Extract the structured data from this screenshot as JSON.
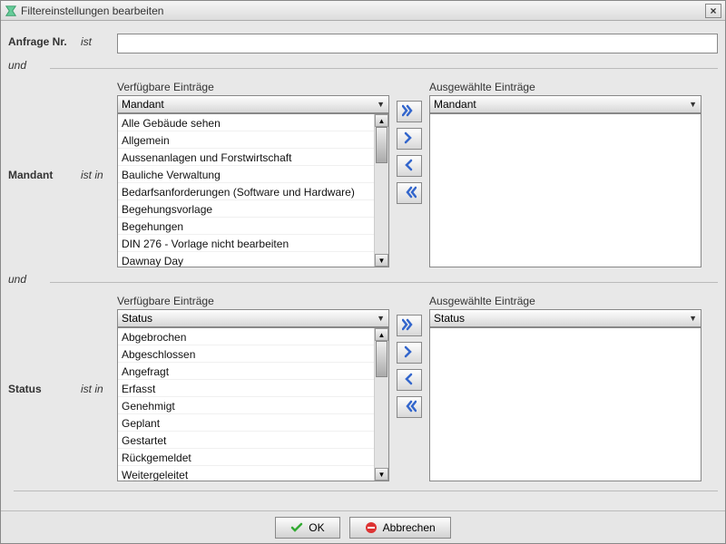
{
  "window": {
    "title": "Filtereinstellungen bearbeiten",
    "close_symbol": "×"
  },
  "fields": {
    "anfrage_label": "Anfrage Nr.",
    "op_ist": "ist",
    "and": "und",
    "mandant_label": "Mandant",
    "op_istin": "ist in",
    "status_label": "Status",
    "available_title": "Verfügbare Einträge",
    "selected_title": "Ausgewählte Einträge",
    "anfrage_value": ""
  },
  "mandant": {
    "dropdown_value": "Mandant",
    "available": [
      "Alle Gebäude sehen",
      "Allgemein",
      "Aussenanlagen und Forstwirtschaft",
      "Bauliche Verwaltung",
      "Bedarfsanforderungen (Software und Hardware)",
      "Begehungsvorlage",
      "Begehungen",
      "DIN 276 - Vorlage nicht bearbeiten",
      "Dawnay Day"
    ],
    "selected_dropdown_value": "Mandant"
  },
  "status": {
    "dropdown_value": "Status",
    "available": [
      "Abgebrochen",
      "Abgeschlossen",
      "Angefragt",
      "Erfasst",
      "Genehmigt",
      "Geplant",
      "Gestartet",
      "Rückgemeldet",
      "Weitergeleitet"
    ],
    "selected_dropdown_value": "Status"
  },
  "footer": {
    "ok_label": "OK",
    "cancel_label": "Abbrechen"
  }
}
